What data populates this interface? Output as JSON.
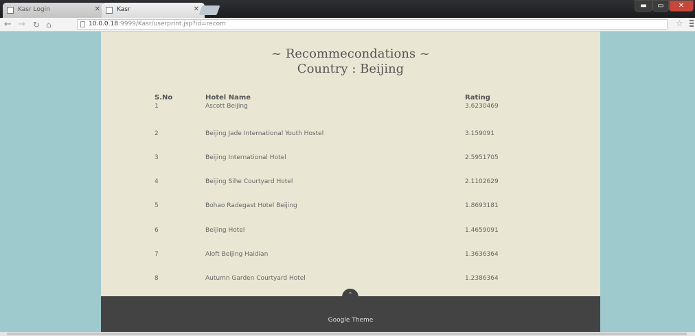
{
  "browser": {
    "tabs": [
      {
        "title": "Kasr Login",
        "active": false
      },
      {
        "title": "Kasr",
        "active": true
      }
    ],
    "address": {
      "host": "10.0.0.18",
      "path": ":9999/Kasr/userprint.jsp?id=recom"
    }
  },
  "page": {
    "title": "~ Recommecondations ~",
    "subtitle": "Country : Beijing",
    "columns": {
      "sno": "S.No",
      "hotel": "Hotel Name",
      "rating": "Rating"
    },
    "rows": [
      {
        "sno": "1",
        "hotel": "Ascott Beijing",
        "rating": "3.6230469"
      },
      {
        "sno": "2",
        "hotel": "Beijing Jade International Youth Hostel",
        "rating": "3.159091"
      },
      {
        "sno": "3",
        "hotel": "Beijing International Hotel",
        "rating": "2.5951705"
      },
      {
        "sno": "4",
        "hotel": "Beijing Sihe Courtyard Hotel",
        "rating": "2.1102629"
      },
      {
        "sno": "5",
        "hotel": "Bohao Radegast Hotel Beijing",
        "rating": "1.8693181"
      },
      {
        "sno": "6",
        "hotel": "Beijing Hotel",
        "rating": "1.4659091"
      },
      {
        "sno": "7",
        "hotel": "Aloft Beijing Haidian",
        "rating": "1.3636364"
      },
      {
        "sno": "8",
        "hotel": "Autumn Garden Courtyard Hotel",
        "rating": "1.2386364"
      }
    ],
    "footer": "Google Theme"
  },
  "icons": {
    "back": "back-arrow-icon",
    "forward": "forward-arrow-icon",
    "reload": "reload-icon",
    "home": "home-icon",
    "star": "star-icon",
    "to_top": "up-arrow-icon"
  }
}
